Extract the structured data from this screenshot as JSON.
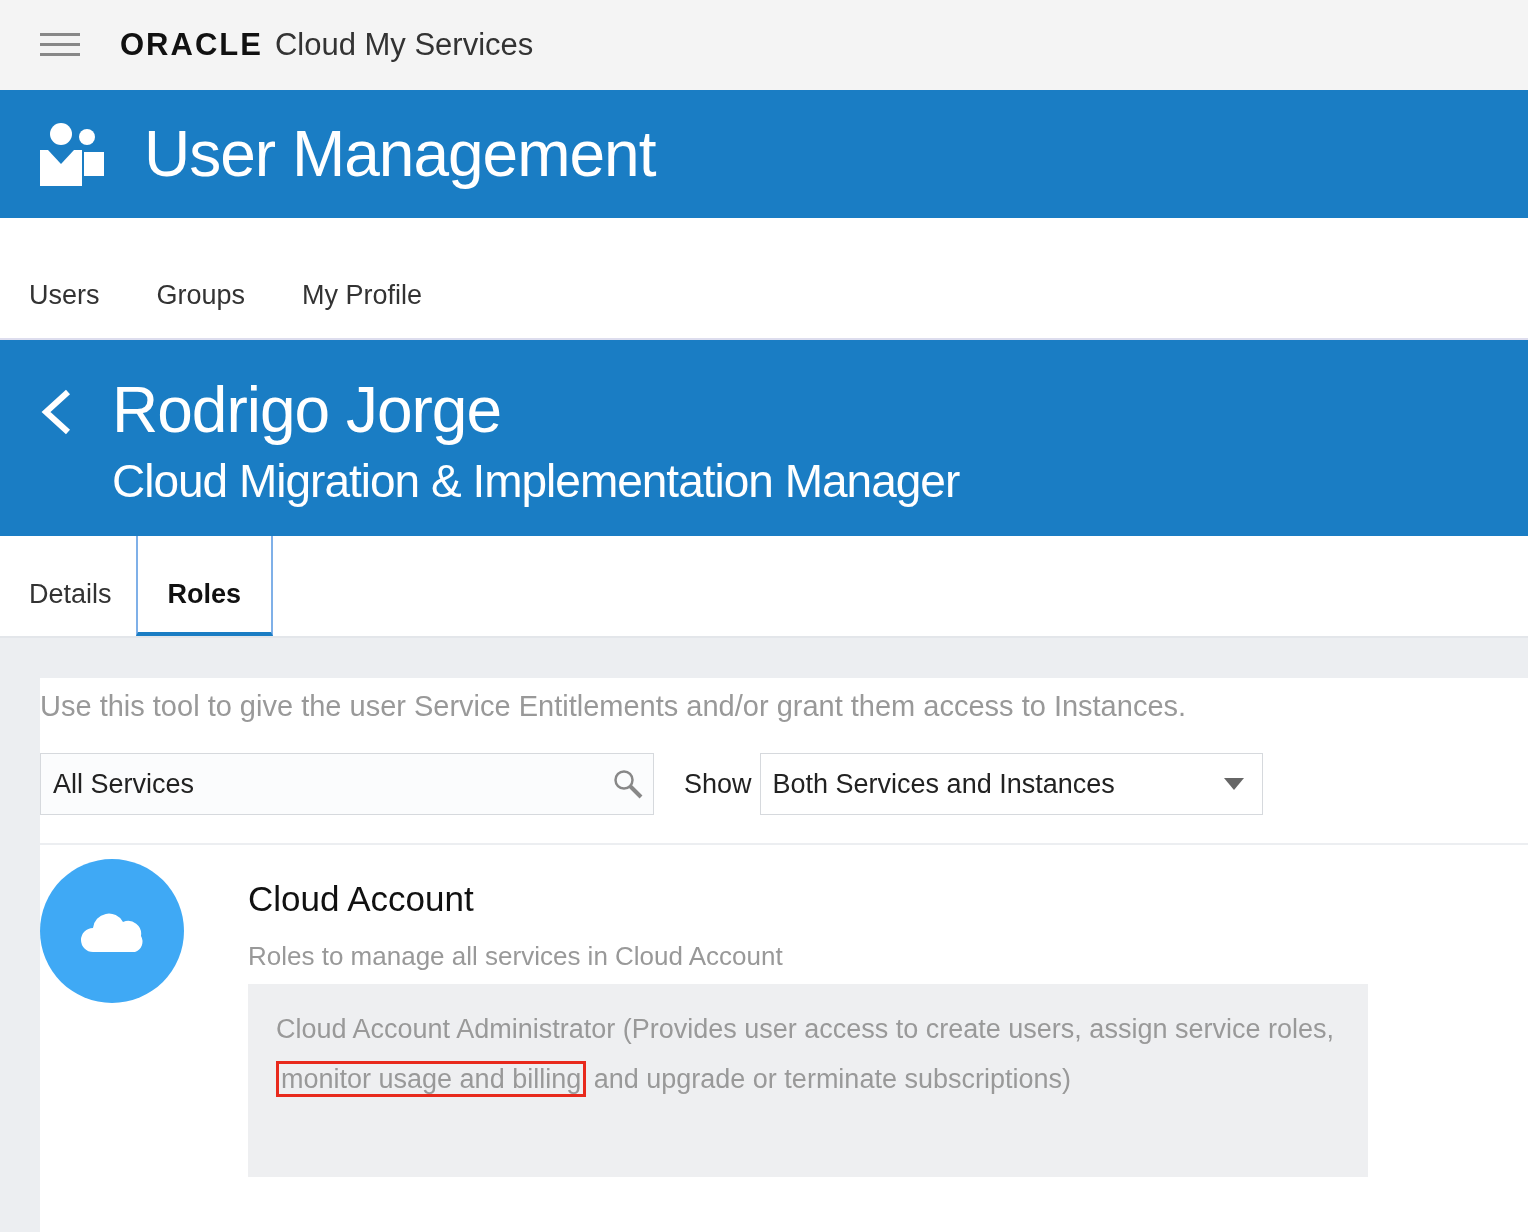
{
  "top_bar": {
    "logo": "ORACLE",
    "title": "Cloud My Services"
  },
  "banner": {
    "title": "User Management"
  },
  "nav": [
    {
      "label": "Users",
      "selected": false
    },
    {
      "label": "Groups",
      "selected": false
    },
    {
      "label": "My Profile",
      "selected": false
    }
  ],
  "user_header": {
    "name": "Rodrigo Jorge",
    "role": "Cloud Migration & Implementation Manager"
  },
  "tabs": [
    {
      "label": "Details",
      "selected": false
    },
    {
      "label": "Roles",
      "selected": true
    }
  ],
  "intro": "Use this tool to give the user Service Entitlements and/or grant them access to Instances.",
  "search": {
    "value": "All Services"
  },
  "show": {
    "label": "Show",
    "value": "Both Services and Instances"
  },
  "service": {
    "title": "Cloud Account",
    "subtitle": "Roles to manage all services in Cloud Account",
    "role": {
      "before": "Cloud Account Administrator (Provides user access to create users, assign service roles,",
      "highlight": "monitor usage and billing",
      "after": "and upgrade or terminate subscriptions)"
    }
  }
}
